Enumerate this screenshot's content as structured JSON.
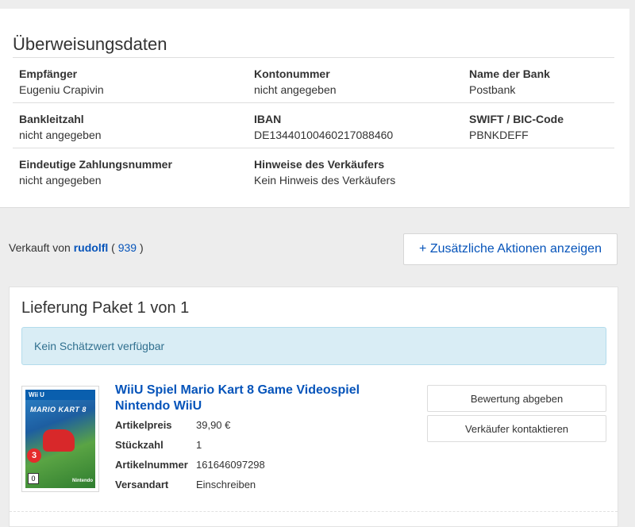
{
  "transfer": {
    "title": "Überweisungsdaten",
    "rows": [
      [
        {
          "label": "Empfänger",
          "value": "Eugeniu Crapivin"
        },
        {
          "label": "Kontonummer",
          "value": "nicht angegeben"
        },
        {
          "label": "Name der Bank",
          "value": "Postbank"
        }
      ],
      [
        {
          "label": "Bankleitzahl",
          "value": "nicht angegeben"
        },
        {
          "label": "IBAN",
          "value": "DE13440100460217088460"
        },
        {
          "label": "SWIFT / BIC-Code",
          "value": "PBNKDEFF"
        }
      ],
      [
        {
          "label": "Eindeutige Zahlungsnummer",
          "value": "nicht angegeben"
        },
        {
          "label": "Hinweise des Verkäufers",
          "value": "Kein Hinweis des Verkäufers"
        }
      ]
    ]
  },
  "seller": {
    "prefix": "Verkauft von",
    "name": "rudolfl",
    "open_paren": "(",
    "rating": "939",
    "close_paren": ")",
    "more_actions_label": "+ Zusätzliche Aktionen anzeigen"
  },
  "delivery": {
    "title": "Lieferung Paket 1 von 1",
    "estimate": "Kein Schätzwert verfügbar",
    "product": {
      "title": "WiiU Spiel Mario Kart 8 Game Videospiel Nintendo WiiU",
      "cover": {
        "platform": "Wii U",
        "logo": "MARIO KART 8",
        "badge": "3",
        "age": "0",
        "brand": "Nintendo"
      },
      "specs": [
        {
          "label": "Artikelpreis",
          "value": "39,90 €"
        },
        {
          "label": "Stückzahl",
          "value": "1"
        },
        {
          "label": "Artikelnummer",
          "value": "161646097298"
        },
        {
          "label": "Versandart",
          "value": "Einschreiben"
        }
      ]
    },
    "actions": {
      "feedback": "Bewertung abgeben",
      "contact": "Verkäufer kontaktieren"
    }
  },
  "colors": {
    "link": "#0654ba",
    "info_bg": "#d9edf5",
    "info_text": "#31708f",
    "page_bg": "#ededed"
  }
}
